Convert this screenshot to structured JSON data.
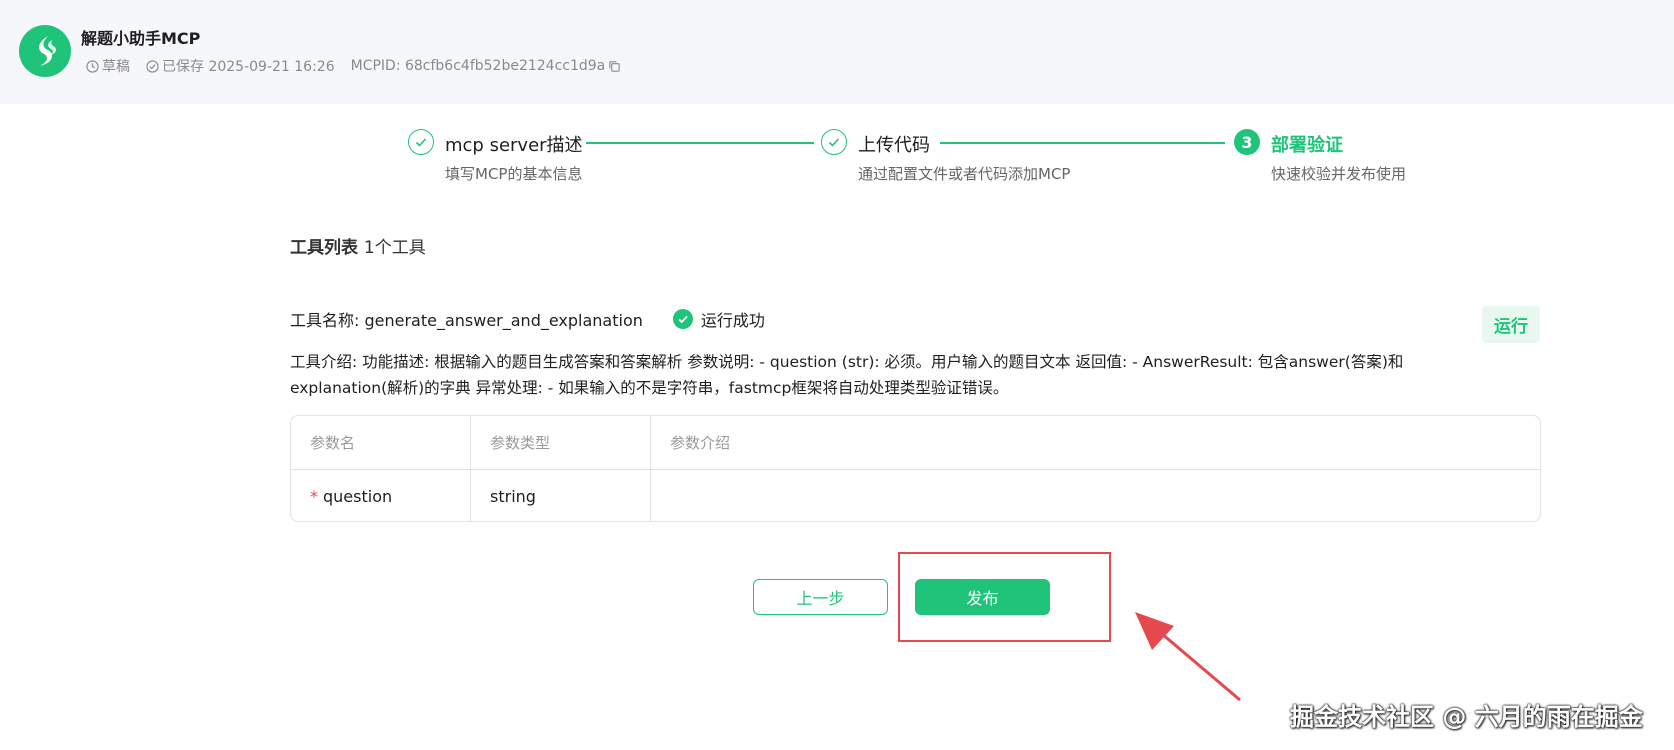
{
  "header": {
    "title": "解题小助手MCP",
    "status": "草稿",
    "saved": "已保存 2025-09-21 16:26",
    "mcpid": "MCPID: 68cfb6c4fb52be2124cc1d9a"
  },
  "steps": [
    {
      "title": "mcp server描述",
      "desc": "填写MCP的基本信息",
      "state": "done"
    },
    {
      "title": "上传代码",
      "desc": "通过配置文件或者代码添加MCP",
      "state": "done"
    },
    {
      "number": "3",
      "title": "部署验证",
      "desc": "快速校验并发布使用",
      "state": "current"
    }
  ],
  "tools": {
    "section_title": "工具列表",
    "count": "1个工具",
    "name_label": "工具名称: generate_answer_and_explanation",
    "status": "运行成功",
    "run_label": "运行",
    "description": "工具介绍: 功能描述: 根据输入的题目生成答案和答案解析 参数说明: - question (str): 必须。用户输入的题目文本 返回值: - AnswerResult: 包含answer(答案)和explanation(解析)的字典 异常处理: - 如果输入的不是字符串，fastmcp框架将自动处理类型验证错误。",
    "table": {
      "headers": [
        "参数名",
        "参数类型",
        "参数介绍"
      ],
      "rows": [
        {
          "required": "*",
          "name": "question",
          "type": "string",
          "desc": ""
        }
      ]
    }
  },
  "footer": {
    "prev_label": "上一步",
    "publish_label": "发布"
  },
  "watermark": "掘金技术社区 @ 六月的雨在掘金",
  "colors": {
    "accent": "#1fc47a",
    "highlight": "#e5484d"
  }
}
